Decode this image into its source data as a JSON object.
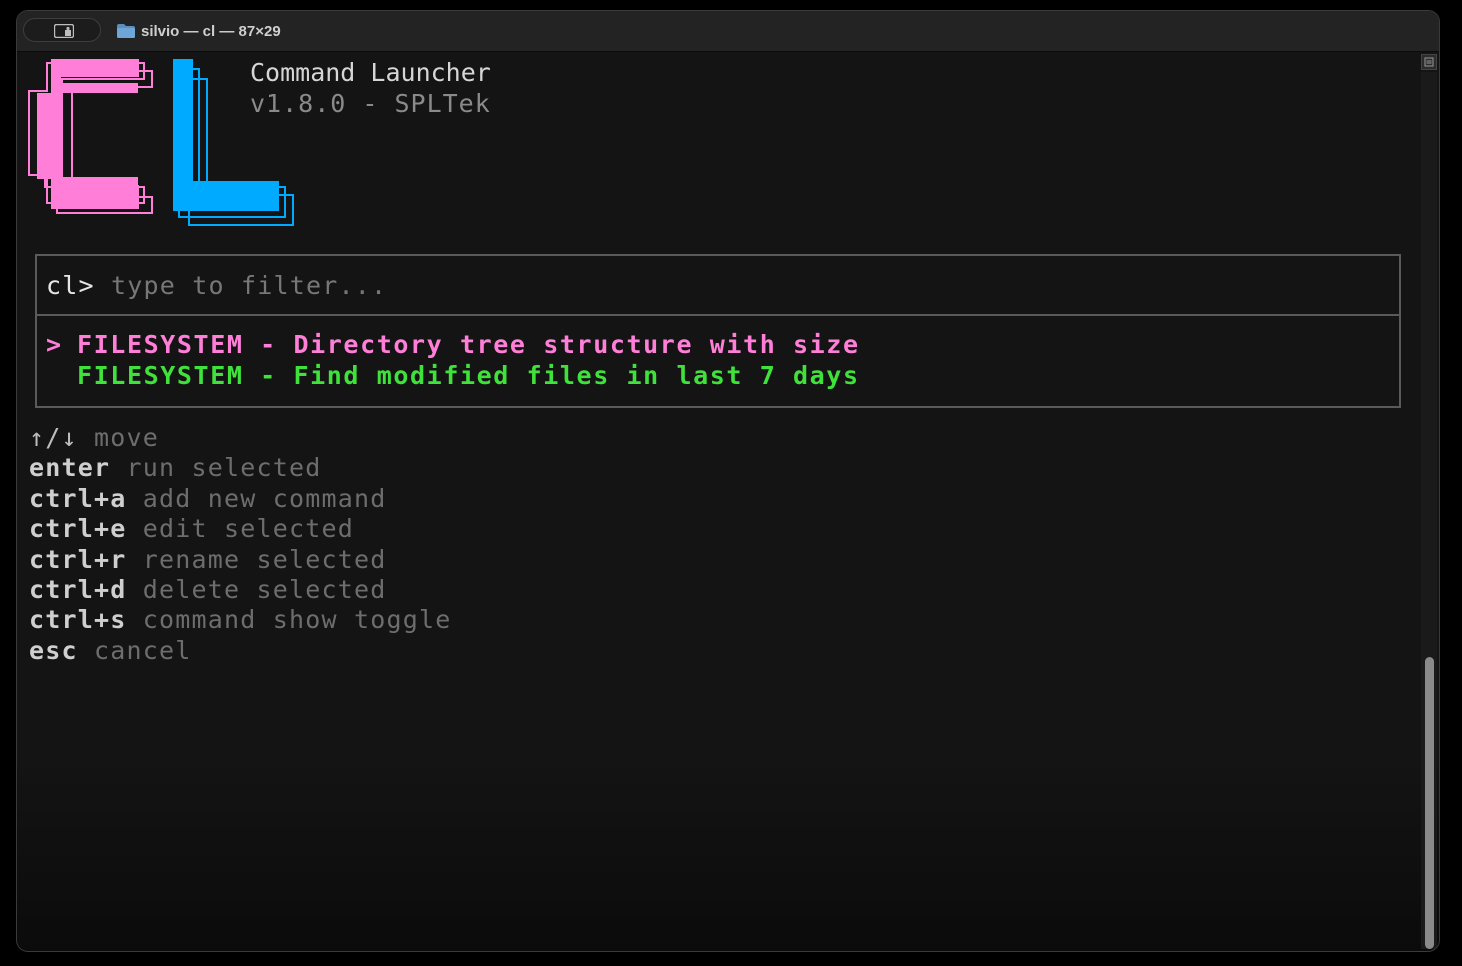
{
  "window": {
    "title": "silvio — cl — 87×29"
  },
  "logo": {
    "text": "CL",
    "colors": {
      "c": "#ff7fd8",
      "l": "#00aaff"
    }
  },
  "header": {
    "app_name": "Command Launcher",
    "version_line": "v1.8.0 - SPLTek"
  },
  "filter": {
    "prompt": "cl> ",
    "value": "",
    "placeholder": "type to filter..."
  },
  "results": [
    {
      "marker": ">",
      "text": "FILESYSTEM - Directory tree structure with size",
      "selected": true
    },
    {
      "marker": "",
      "text": "FILESYSTEM - Find modified files in last 7 days",
      "selected": false
    }
  ],
  "keybinds": [
    {
      "key": "↑/↓",
      "desc": "move"
    },
    {
      "key": "enter",
      "desc": "run selected"
    },
    {
      "key": "ctrl+a",
      "desc": "add new command"
    },
    {
      "key": "ctrl+e",
      "desc": "edit selected"
    },
    {
      "key": "ctrl+r",
      "desc": "rename selected"
    },
    {
      "key": "ctrl+d",
      "desc": "delete selected"
    },
    {
      "key": "ctrl+s",
      "desc": "command show toggle"
    },
    {
      "key": "esc",
      "desc": "cancel"
    }
  ],
  "colors": {
    "selected_row": "#ff7fd8",
    "normal_row": "#3fe23a",
    "background": "#141414",
    "border": "#5a5a5a"
  },
  "icons": {
    "titlebar_left": "sidebar-profile-icon",
    "title_folder": "folder-icon",
    "scroll_top": "scroll-marker-icon"
  },
  "scrollbar": {
    "thumb_position": "bottom"
  }
}
